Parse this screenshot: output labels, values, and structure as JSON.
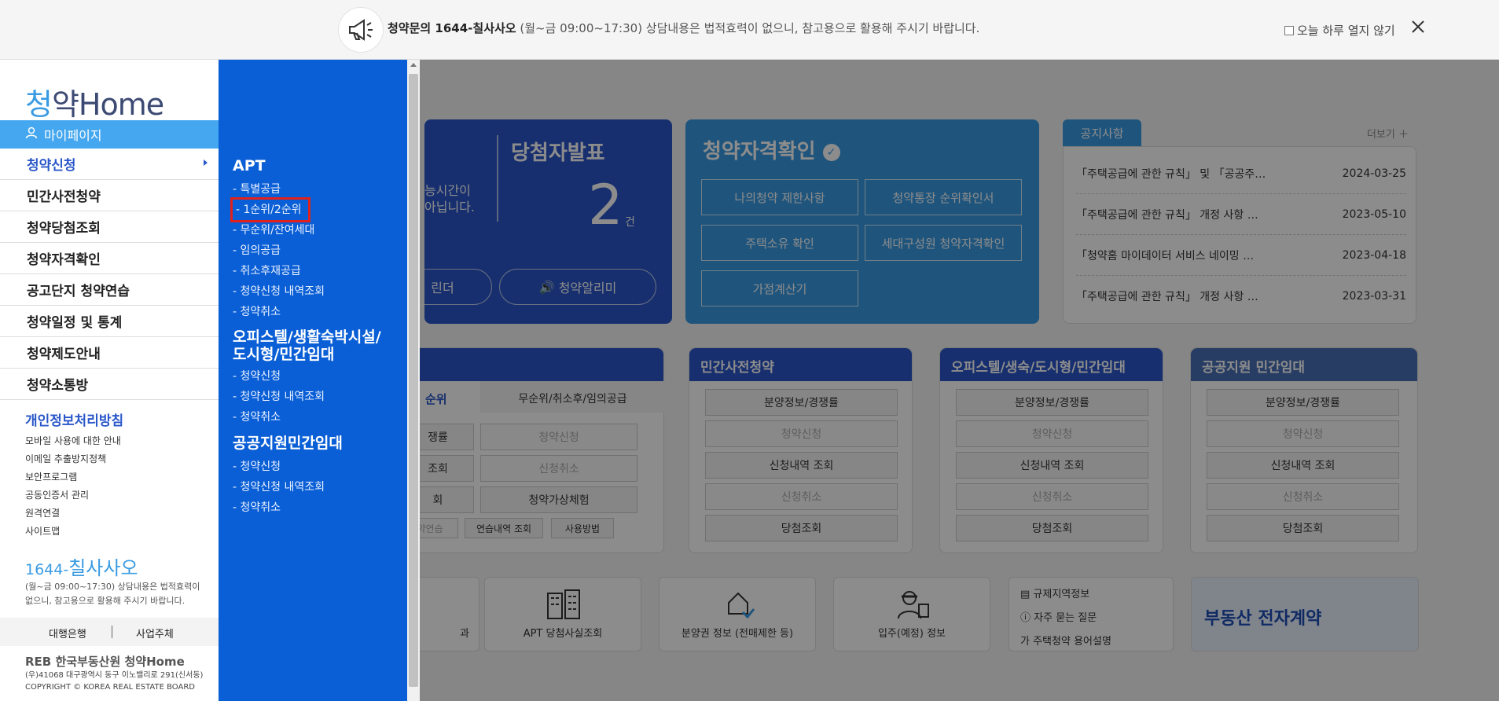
{
  "topbar": {
    "notice_bold": "청약문의 1644-칠사사오",
    "notice_rest": " (월~금 09:00~17:30) 상담내용은 법적효력이 없으니, 참고용으로 활용해 주시기 바랍니다.",
    "today_label": "오늘 하루 열지 않기"
  },
  "sidebar": {
    "logo_accent": "청",
    "logo_rest": "약Home",
    "mypage": "마이페이지",
    "items": [
      "청약신청",
      "민간사전청약",
      "청약당첨조회",
      "청약자격확인",
      "공고단지 청약연습",
      "청약일정 및 통계",
      "청약제도안내",
      "청약소통방"
    ],
    "privacy": "개인정보처리방침",
    "links": [
      "모바일 사용에 대한 안내",
      "이메일 추출방지정책",
      "보안프로그램",
      "공동인증서 관리",
      "원격연결",
      "사이트맵"
    ],
    "phone_prefix": "1644-",
    "phone_name": "칠사사오",
    "phone_desc": "(월~금 09:00~17:30) 상담내용은 법적효력이 없으니, 참고용으로 활용해 주시기 바랍니다.",
    "agency_bank": "대행은행",
    "agency_biz": "사업주체",
    "footer_logo": "REB 한국부동산원 청약Home",
    "address": "(우)41068 대구광역시 동구 이노밸리로 291(신서동)",
    "copyright": "COPYRIGHT © KOREA REAL ESTATE BOARD"
  },
  "submenu": {
    "apt_title": "APT",
    "apt_links": [
      "- 특별공급",
      "- 1순위/2순위",
      "- 무순위/잔여세대",
      "- 임의공급",
      "- 취소후재공급",
      "- 청약신청 내역조회",
      "- 청약취소"
    ],
    "officetel_title": "오피스텔/생활숙박시설/도시형/민간임대",
    "officetel_links": [
      "- 청약신청",
      "- 청약신청 내역조회",
      "- 청약취소"
    ],
    "public_title": "공공지원민간임대",
    "public_links": [
      "- 청약신청",
      "- 청약신청 내역조회",
      "- 청약취소"
    ]
  },
  "background": {
    "winner_title": "당첨자발표",
    "winner_count": "2",
    "winner_unit": "건",
    "partial_text": "능시간이\n아닙니다.",
    "pill_left": "린더",
    "pill_right": "청약알리미",
    "qual_title": "청약자격확인",
    "qual_buttons": [
      "나의청약 제한사항",
      "청약통장 순위확인서",
      "주택소유 확인",
      "세대구성원 청약자격확인",
      "가점계산기"
    ],
    "notice_tab": "공지사항",
    "notice_more": "더보기",
    "notices": [
      {
        "title": "「주택공급에 관한 규칙」 및 「공공주…",
        "date": "2024-03-25"
      },
      {
        "title": "「주택공급에 관한 규칙」 개정 사항 …",
        "date": "2023-05-10"
      },
      {
        "title": "「청약홈 마이데이터 서비스 네이밍 …",
        "date": "2023-04-18"
      },
      {
        "title": "「주택공급에 관한 규칙」 개정 사항 …",
        "date": "2023-03-31"
      }
    ],
    "apt_tab_active": "순위",
    "apt_tab_other": "무순위/취소후/임의공급",
    "apt_cells": [
      "쟁률",
      "청약신청",
      "조회",
      "신청취소",
      "회",
      "청약가상체험"
    ],
    "apt_small": [
      "약연습",
      "연습내역 조회",
      "사용방법"
    ],
    "svc_cards": [
      {
        "title": "민간사전청약",
        "buttons": [
          "분양정보/경쟁률",
          "청약신청",
          "신청내역 조회",
          "신청취소",
          "당첨조회"
        ]
      },
      {
        "title": "오피스텔/생숙/도시형/민간임대",
        "buttons": [
          "분양정보/경쟁률",
          "청약신청",
          "신청내역 조회",
          "신청취소",
          "당첨조회"
        ]
      },
      {
        "title": "공공지원 민간임대",
        "buttons": [
          "분양정보/경쟁률",
          "청약신청",
          "신청내역 조회",
          "신청취소",
          "당첨조회"
        ]
      }
    ],
    "tiles": [
      "과",
      "APT 당첨사실조회",
      "분양권 정보 (전매제한 등)",
      "입주(예정) 정보"
    ],
    "quick": [
      "규제지역정보",
      "자주 묻는 질문",
      "주택청약 용어설명"
    ],
    "banner_title": "부동산 전자계약"
  }
}
